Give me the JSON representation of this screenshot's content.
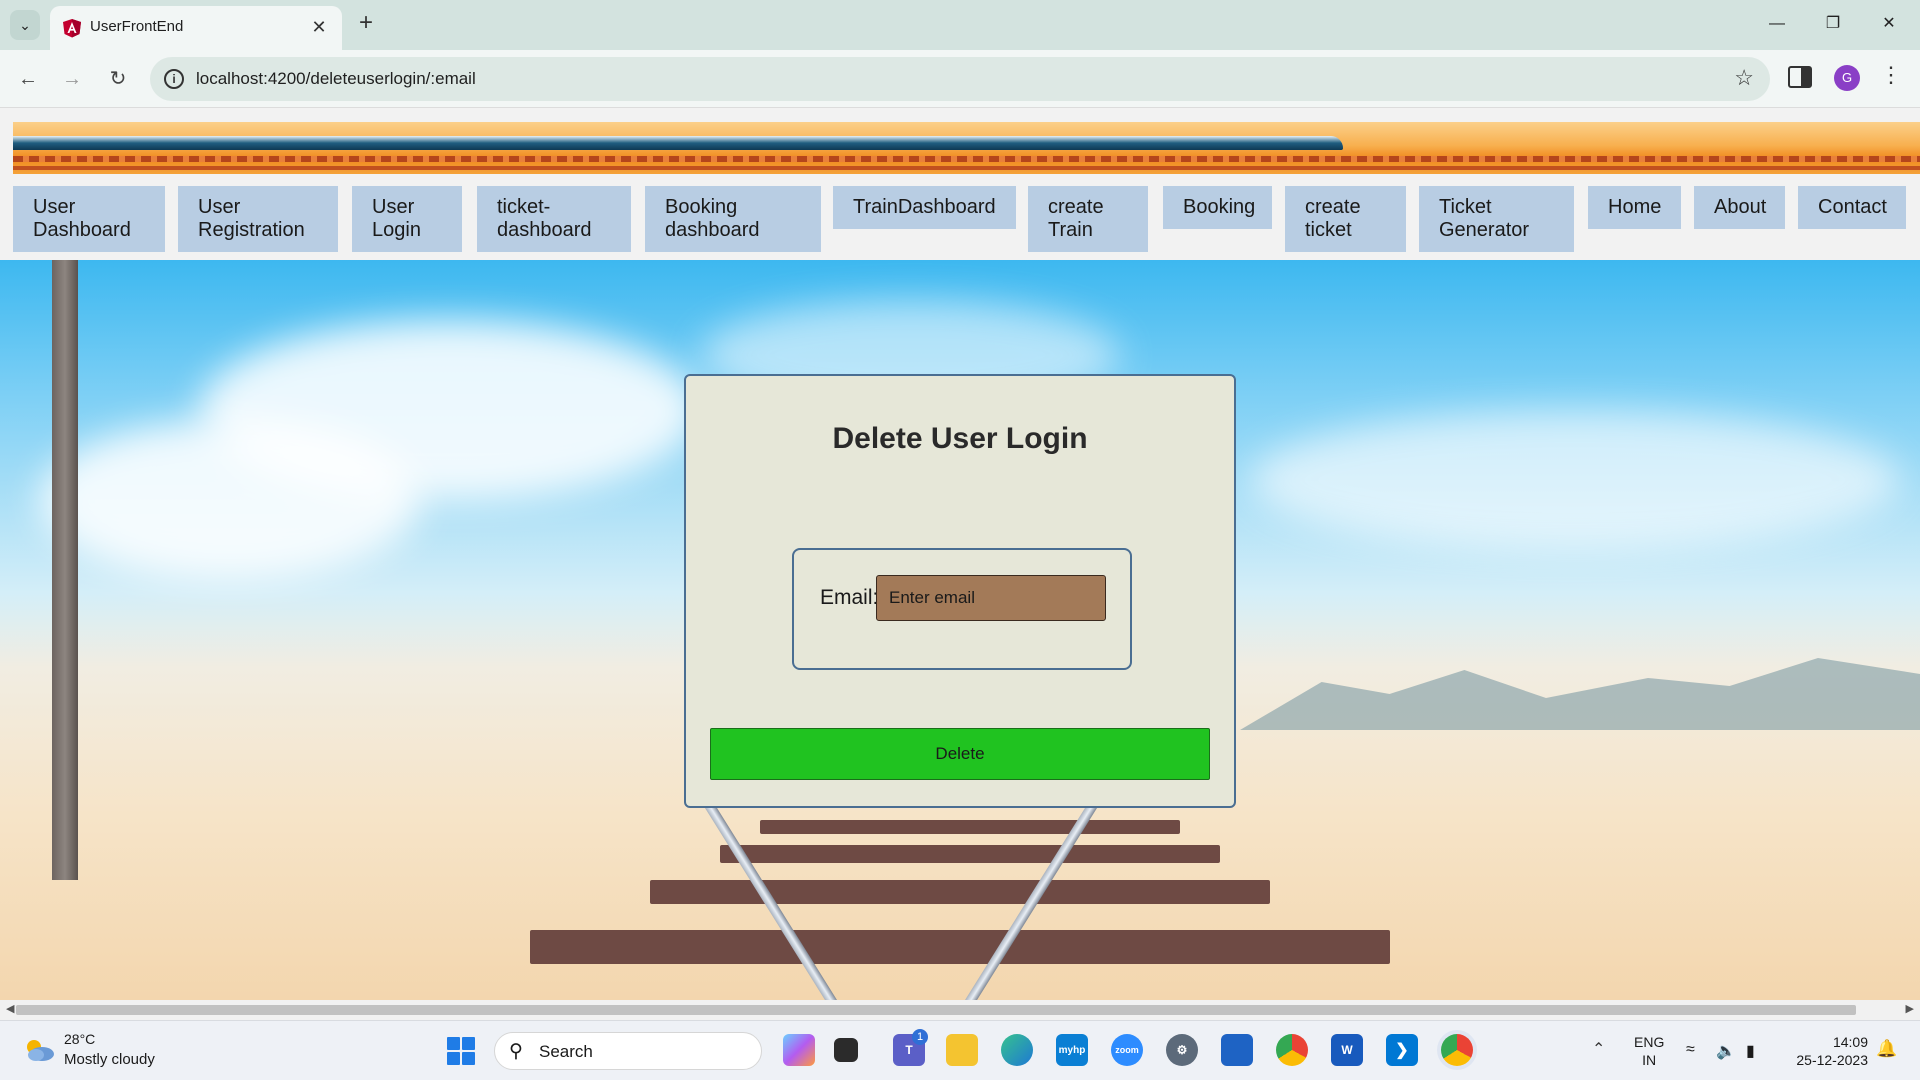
{
  "browser": {
    "tab_title": "UserFrontEnd",
    "url": "localhost:4200/deleteuserlogin/:email",
    "profile_initial": "G"
  },
  "nav": {
    "items": [
      {
        "label": "User\nDashboard"
      },
      {
        "label": "User\nRegistration"
      },
      {
        "label": "User\nLogin"
      },
      {
        "label": "ticket-\ndashboard"
      },
      {
        "label": "Booking\ndashboard"
      },
      {
        "label": "TrainDashboard"
      },
      {
        "label": "create\nTrain"
      },
      {
        "label": "Booking"
      },
      {
        "label": "create\nticket"
      },
      {
        "label": "Ticket\nGenerator"
      },
      {
        "label": "Home"
      },
      {
        "label": "About"
      },
      {
        "label": "Contact"
      }
    ]
  },
  "card": {
    "title": "Delete User Login",
    "email_label": "Email:",
    "email_placeholder": "Enter email",
    "email_value": "",
    "delete_label": "Delete"
  },
  "taskbar": {
    "temperature": "28°C",
    "weather": "Mostly cloudy",
    "search_label": "Search",
    "teams_badge": "1",
    "lang_line1": "ENG",
    "lang_line2": "IN",
    "time": "14:09",
    "date": "25-12-2023"
  },
  "colors": {
    "nav_item_bg": "#b8cde3",
    "card_bg": "#e6e7d8",
    "card_border": "#4a6e92",
    "input_bg": "#a37a58",
    "delete_bg": "#20c320"
  }
}
